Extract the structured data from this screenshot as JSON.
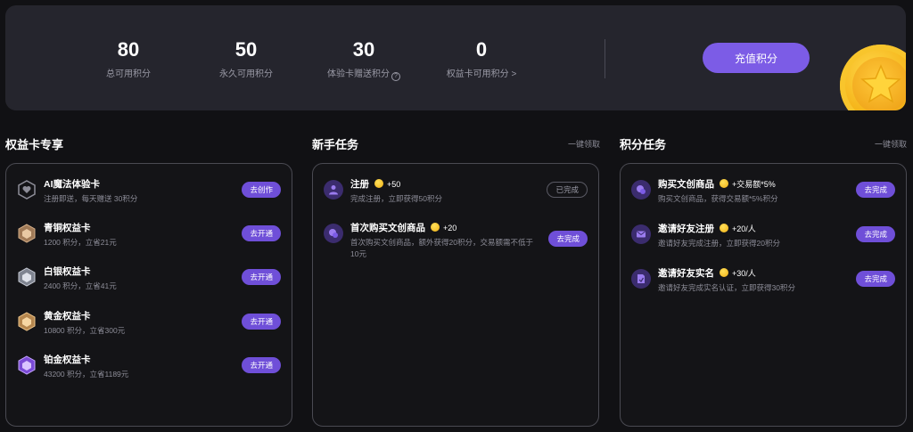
{
  "stats": [
    {
      "value": "80",
      "label": "总可用积分"
    },
    {
      "value": "50",
      "label": "永久可用积分"
    },
    {
      "value": "30",
      "label": "体验卡赠送积分"
    },
    {
      "value": "0",
      "label": "权益卡可用积分 >"
    }
  ],
  "recharge_label": "充值积分",
  "sections": {
    "membership": {
      "title": "权益卡专享",
      "items": [
        {
          "title": "AI魔法体验卡",
          "desc": "注册即送，每天赠送 30积分",
          "button": "去创作",
          "icon": "hexagon-heart-icon"
        },
        {
          "title": "青铜权益卡",
          "desc": "1200 积分，立省21元",
          "button": "去开通",
          "icon": "bronze-card-icon"
        },
        {
          "title": "白银权益卡",
          "desc": "2400 积分，立省41元",
          "button": "去开通",
          "icon": "silver-card-icon"
        },
        {
          "title": "黄金权益卡",
          "desc": "10800 积分，立省300元",
          "button": "去开通",
          "icon": "gold-card-icon"
        },
        {
          "title": "铂金权益卡",
          "desc": "43200 积分，立省1189元",
          "button": "去开通",
          "icon": "platinum-card-icon"
        }
      ]
    },
    "newbie": {
      "title": "新手任务",
      "link": "一键领取",
      "items": [
        {
          "title": "注册",
          "reward": "+50",
          "desc": "完成注册，立即获得50积分",
          "button": "已完成",
          "icon": "user-icon"
        },
        {
          "title": "首次购买文创商品",
          "reward": "+20",
          "desc_line1": "首次购买文创商品，额外获得20积分，交易额需不低于",
          "desc_line2": "10元",
          "button": "去完成",
          "icon": "chat-icon"
        }
      ]
    },
    "points": {
      "title": "积分任务",
      "link": "一键领取",
      "items": [
        {
          "title": "购买文创商品",
          "reward": "+交易额*5%",
          "desc": "购买文创商品，获得交易额*5%积分",
          "button": "去完成",
          "icon": "chat-icon"
        },
        {
          "title": "邀请好友注册",
          "reward": "+20/人",
          "desc": "邀请好友完成注册，立即获得20积分",
          "button": "去完成",
          "icon": "mail-icon"
        },
        {
          "title": "邀请好友实名",
          "reward": "+30/人",
          "desc": "邀请好友完成实名认证，立即获得30积分",
          "button": "去完成",
          "icon": "document-icon"
        }
      ]
    }
  }
}
